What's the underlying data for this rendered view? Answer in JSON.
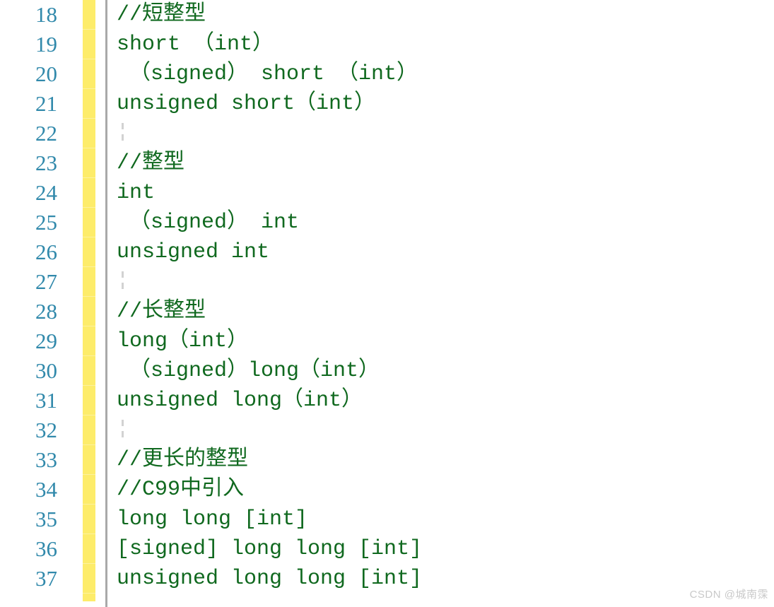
{
  "editor": {
    "language": "c",
    "first_line_number": 18,
    "line_height_px": 42,
    "colors": {
      "background": "#ffffff",
      "line_number": "#3189ab",
      "code_text": "#10691f",
      "comment_text": "#10691f",
      "change_bar": "#fdec6a",
      "separator": "#a9a9a9",
      "indent_guide": "#d2d2d2",
      "watermark": "#c9c9c9"
    },
    "lines": [
      {
        "number": "18",
        "text": "//短整型",
        "kind": "comment",
        "blank": false,
        "modified": true
      },
      {
        "number": "19",
        "text": "short （int）",
        "kind": "code",
        "blank": false,
        "modified": true
      },
      {
        "number": "20",
        "text": " （signed） short （int）",
        "kind": "code",
        "blank": false,
        "modified": true
      },
      {
        "number": "21",
        "text": "unsigned short（int）",
        "kind": "code",
        "blank": false,
        "modified": true
      },
      {
        "number": "22",
        "text": "",
        "kind": "blank",
        "blank": true,
        "modified": true
      },
      {
        "number": "23",
        "text": "//整型",
        "kind": "comment",
        "blank": false,
        "modified": true
      },
      {
        "number": "24",
        "text": "int",
        "kind": "code",
        "blank": false,
        "modified": true
      },
      {
        "number": "25",
        "text": " （signed） int",
        "kind": "code",
        "blank": false,
        "modified": true
      },
      {
        "number": "26",
        "text": "unsigned int",
        "kind": "code",
        "blank": false,
        "modified": true
      },
      {
        "number": "27",
        "text": "",
        "kind": "blank",
        "blank": true,
        "modified": true
      },
      {
        "number": "28",
        "text": "//长整型",
        "kind": "comment",
        "blank": false,
        "modified": true
      },
      {
        "number": "29",
        "text": "long（int）",
        "kind": "code",
        "blank": false,
        "modified": true
      },
      {
        "number": "30",
        "text": " （signed）long（int）",
        "kind": "code",
        "blank": false,
        "modified": true
      },
      {
        "number": "31",
        "text": "unsigned long（int）",
        "kind": "code",
        "blank": false,
        "modified": true
      },
      {
        "number": "32",
        "text": "",
        "kind": "blank",
        "blank": true,
        "modified": true
      },
      {
        "number": "33",
        "text": "//更长的整型",
        "kind": "comment",
        "blank": false,
        "modified": true
      },
      {
        "number": "34",
        "text": "//C99中引入",
        "kind": "comment",
        "blank": false,
        "modified": true
      },
      {
        "number": "35",
        "text": "long long [int]",
        "kind": "code",
        "blank": false,
        "modified": true
      },
      {
        "number": "36",
        "text": "[signed] long long [int]",
        "kind": "code",
        "blank": false,
        "modified": true
      },
      {
        "number": "37",
        "text": "unsigned long long [int]",
        "kind": "code",
        "blank": false,
        "modified": true
      }
    ]
  },
  "watermark": {
    "text": "CSDN @城南霂"
  }
}
